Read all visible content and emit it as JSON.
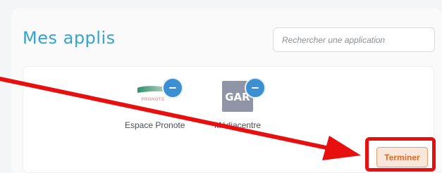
{
  "header": {
    "title": "Mes applis",
    "search_placeholder": "Rechercher une application"
  },
  "apps": [
    {
      "label": "Espace Pronote",
      "logo_text": "PRONOTE",
      "icon": "pronote-logo"
    },
    {
      "label": "Médiacentre",
      "logo_text": "GAR",
      "icon": "gar-logo"
    }
  ],
  "actions": {
    "finish_label": "Terminer"
  },
  "colors": {
    "accent": "#36a3c9",
    "remove_button": "#3c8fd1",
    "finish_text": "#dd6a2a",
    "finish_bg": "#fbe7d9",
    "highlight": "#e80f0f"
  }
}
